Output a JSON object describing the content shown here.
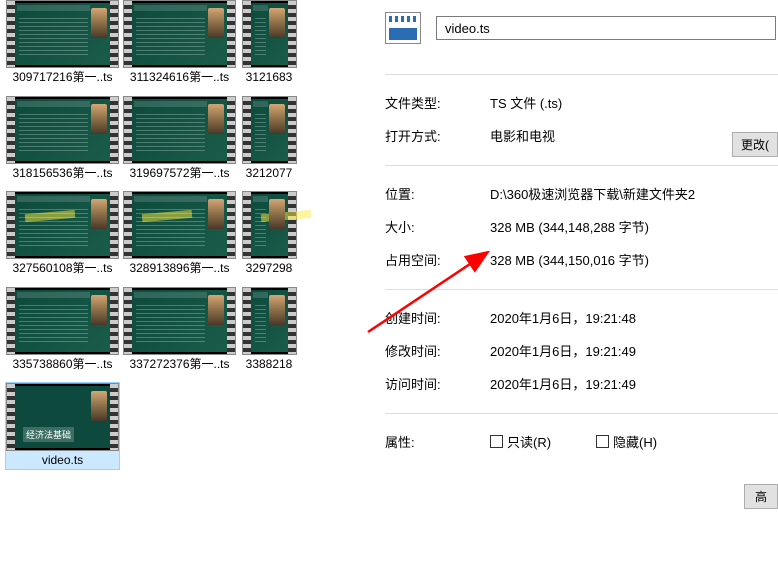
{
  "files": [
    {
      "name": "309717216第一..ts"
    },
    {
      "name": "311324616第一..ts"
    },
    {
      "name": "3121683",
      "partial": true
    },
    {
      "name": "318156536第一..ts"
    },
    {
      "name": "319697572第一..ts"
    },
    {
      "name": "3212077",
      "partial": true
    },
    {
      "name": "327560108第一..ts",
      "highlighted": true
    },
    {
      "name": "328913896第一..ts",
      "highlighted": true
    },
    {
      "name": "3297298",
      "partial": true,
      "highlighted": true
    },
    {
      "name": "335738860第一..ts"
    },
    {
      "name": "337272376第一..ts"
    },
    {
      "name": "3388218",
      "partial": true
    },
    {
      "name": "video.ts",
      "selected": true,
      "special": true
    }
  ],
  "properties": {
    "filename": "video.ts",
    "fileTypeLabel": "文件类型:",
    "fileTypeValue": "TS 文件 (.ts)",
    "opensWithLabel": "打开方式:",
    "opensWithValue": "电影和电视",
    "changeButton": "更改(",
    "locationLabel": "位置:",
    "locationValue": "D:\\360极速浏览器下载\\新建文件夹2",
    "sizeLabel": "大小:",
    "sizeValue": "328 MB (344,148,288 字节)",
    "diskSizeLabel": "占用空间:",
    "diskSizeValue": "328 MB (344,150,016 字节)",
    "createdLabel": "创建时间:",
    "createdValue": "2020年1月6日，19:21:48",
    "modifiedLabel": "修改时间:",
    "modifiedValue": "2020年1月6日，19:21:49",
    "accessedLabel": "访问时间:",
    "accessedValue": "2020年1月6日，19:21:49",
    "attributesLabel": "属性:",
    "readOnlyLabel": "只读(R)",
    "hiddenLabel": "隐藏(H)",
    "advancedButton": "高",
    "videoThumbLabel": "经济法基础"
  }
}
